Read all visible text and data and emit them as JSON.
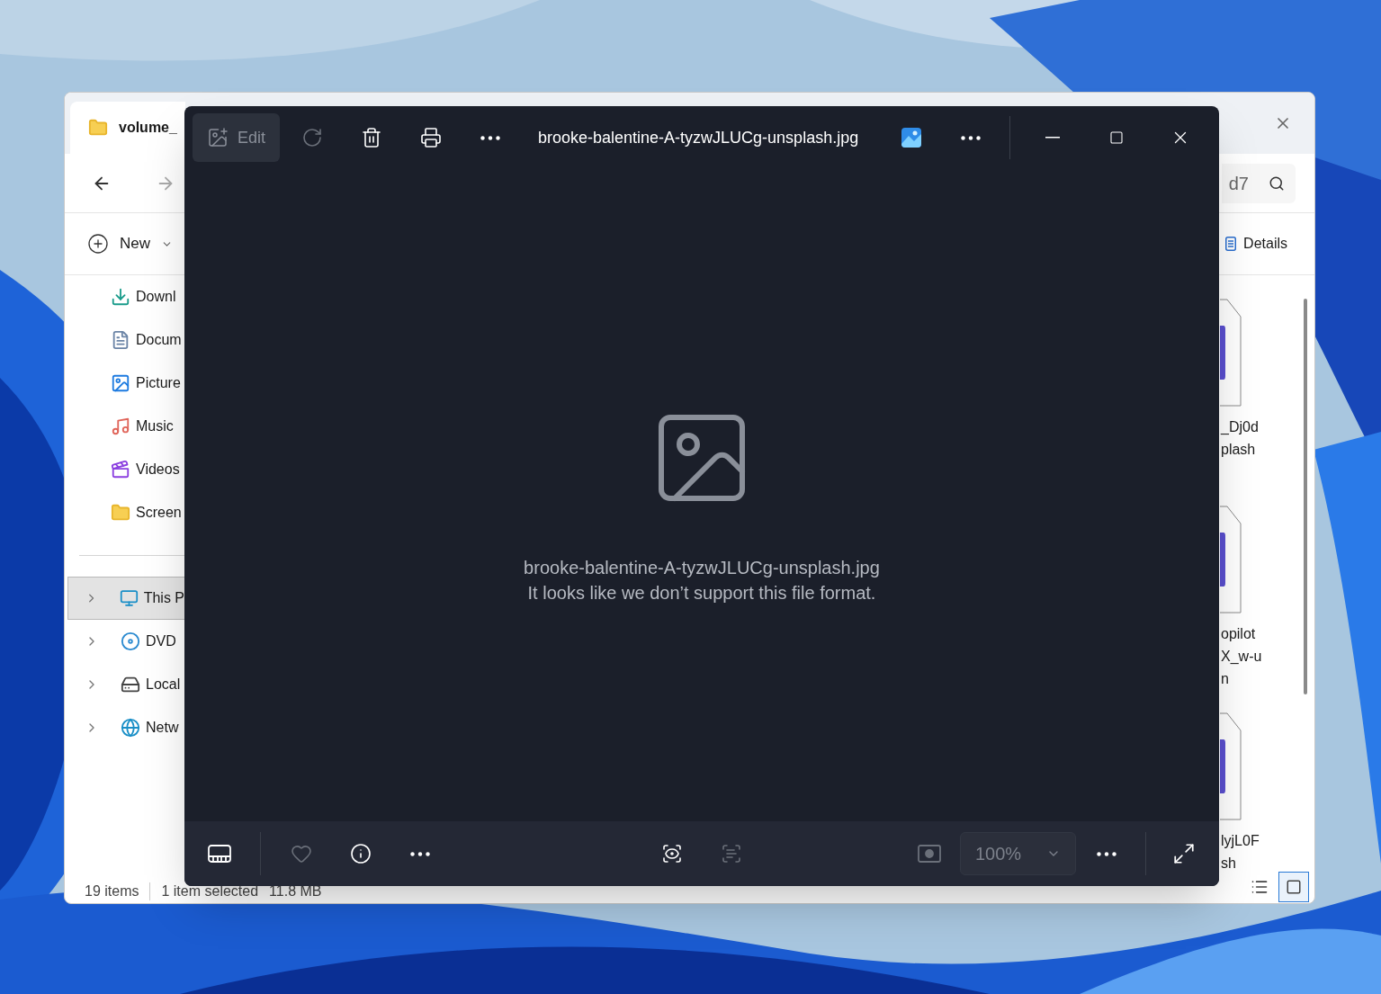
{
  "explorer": {
    "tab_title": "volume_",
    "search_value": "d7",
    "new_label": "New",
    "details_label": "Details",
    "nav_items": [
      {
        "label": "Downl",
        "kind": "downloads"
      },
      {
        "label": "Docum",
        "kind": "documents"
      },
      {
        "label": "Picture",
        "kind": "pictures"
      },
      {
        "label": "Music",
        "kind": "music"
      },
      {
        "label": "Videos",
        "kind": "videos"
      },
      {
        "label": "Screen",
        "kind": "folder"
      }
    ],
    "drives": [
      {
        "label": "This P",
        "kind": "pc",
        "selected": true,
        "expanded": false
      },
      {
        "label": "DVD",
        "kind": "dvd",
        "selected": false,
        "expanded": false
      },
      {
        "label": "Local",
        "kind": "drive",
        "selected": false,
        "expanded": false
      },
      {
        "label": "Netw",
        "kind": "network",
        "selected": false,
        "expanded": false
      }
    ],
    "files": [
      {
        "lines": [
          "_Dj0d",
          "plash"
        ]
      },
      {
        "lines": [
          "opilot",
          "X_w-u",
          "n"
        ]
      },
      {
        "lines": [
          "lyjL0F",
          "sh"
        ]
      }
    ],
    "status": {
      "count": "19 items",
      "selection": "1 item selected",
      "size": "11.8 MB"
    },
    "view_buttons": [
      {
        "kind": "list",
        "selected": false
      },
      {
        "kind": "tiles",
        "selected": true
      }
    ]
  },
  "viewer": {
    "edit_label": "Edit",
    "edit_disabled": true,
    "toolbar": [
      {
        "kind": "rotate",
        "disabled": true
      },
      {
        "kind": "delete",
        "disabled": false
      },
      {
        "kind": "print",
        "disabled": false
      },
      {
        "kind": "more",
        "disabled": false
      }
    ],
    "filename": "brooke-balentine-A-tyzwJLUCg-unsplash.jpg",
    "message": {
      "filename": "brooke-balentine-A-tyzwJLUCg-unsplash.jpg",
      "text": "It looks like we don’t support this file format."
    },
    "bottom_left": [
      {
        "kind": "filmstrip",
        "disabled": false
      },
      {
        "kind": "favorite",
        "disabled": true
      },
      {
        "kind": "info",
        "disabled": false
      },
      {
        "kind": "more",
        "disabled": false
      }
    ],
    "bottom_center": [
      {
        "kind": "visual-search",
        "disabled": false
      },
      {
        "kind": "text-scan",
        "disabled": true
      }
    ],
    "fit": {
      "disabled": true
    },
    "zoom": {
      "value": "100%",
      "disabled": true
    }
  }
}
